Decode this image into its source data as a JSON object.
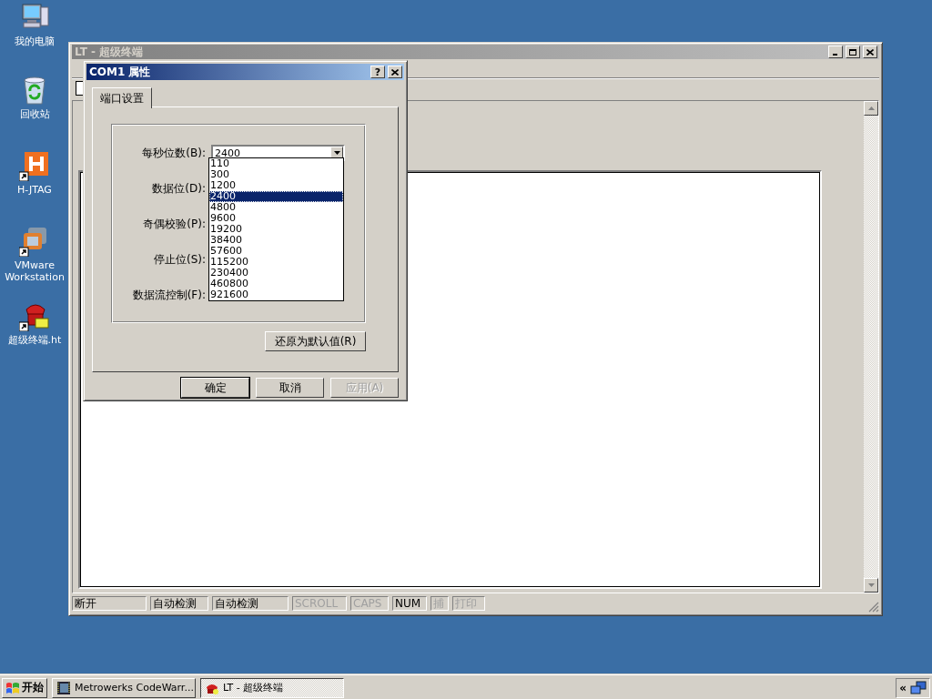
{
  "desktop_icons": [
    {
      "label": "我的电脑",
      "kind": "computer"
    },
    {
      "label": "回收站",
      "kind": "recycle"
    },
    {
      "label": "H-JTAG",
      "kind": "hjtag"
    },
    {
      "label": "VMware Workstation",
      "kind": "vmware"
    },
    {
      "label": "超级终端.ht",
      "kind": "phone"
    }
  ],
  "main_window": {
    "title": "LT - 超级终端",
    "active": false,
    "status_bar": [
      {
        "text": "断开",
        "disabled": false
      },
      {
        "text": "自动检测",
        "disabled": false
      },
      {
        "text": "自动检测",
        "disabled": false
      },
      {
        "text": "SCROLL",
        "disabled": true
      },
      {
        "text": "CAPS",
        "disabled": true
      },
      {
        "text": "NUM",
        "disabled": false
      },
      {
        "text": "捕",
        "disabled": true
      },
      {
        "text": "打印",
        "disabled": true
      }
    ]
  },
  "dialog": {
    "title": "COM1 属性",
    "active": true,
    "help_button": "?",
    "tabs": [
      {
        "label": "端口设置",
        "selected": true
      }
    ],
    "fields": [
      {
        "label": "每秒位数(B):",
        "value": "2400"
      },
      {
        "label": "数据位(D):"
      },
      {
        "label": "奇偶校验(P):"
      },
      {
        "label": "停止位(S):"
      },
      {
        "label": "数据流控制(F):"
      }
    ],
    "dropdown_options": [
      {
        "label": "110",
        "selected": false
      },
      {
        "label": "300",
        "selected": false
      },
      {
        "label": "1200",
        "selected": false
      },
      {
        "label": "2400",
        "selected": true
      },
      {
        "label": "4800",
        "selected": false
      },
      {
        "label": "9600",
        "selected": false
      },
      {
        "label": "19200",
        "selected": false
      },
      {
        "label": "38400",
        "selected": false
      },
      {
        "label": "57600",
        "selected": false
      },
      {
        "label": "115200",
        "selected": false
      },
      {
        "label": "230400",
        "selected": false
      },
      {
        "label": "460800",
        "selected": false
      },
      {
        "label": "921600",
        "selected": false
      }
    ],
    "restore_button": "还原为默认值(R)",
    "buttons": [
      {
        "label": "确定",
        "default": true,
        "disabled": false
      },
      {
        "label": "取消",
        "default": false,
        "disabled": false
      },
      {
        "label": "应用(A)",
        "default": false,
        "disabled": true
      }
    ]
  },
  "taskbar": {
    "start": "开始",
    "tasks": [
      {
        "label": "Metrowerks CodeWarr...",
        "selected": false,
        "kind": "ide"
      },
      {
        "label": "LT - 超级终端",
        "selected": true,
        "kind": "phone"
      }
    ],
    "tray_toggle": "«"
  }
}
